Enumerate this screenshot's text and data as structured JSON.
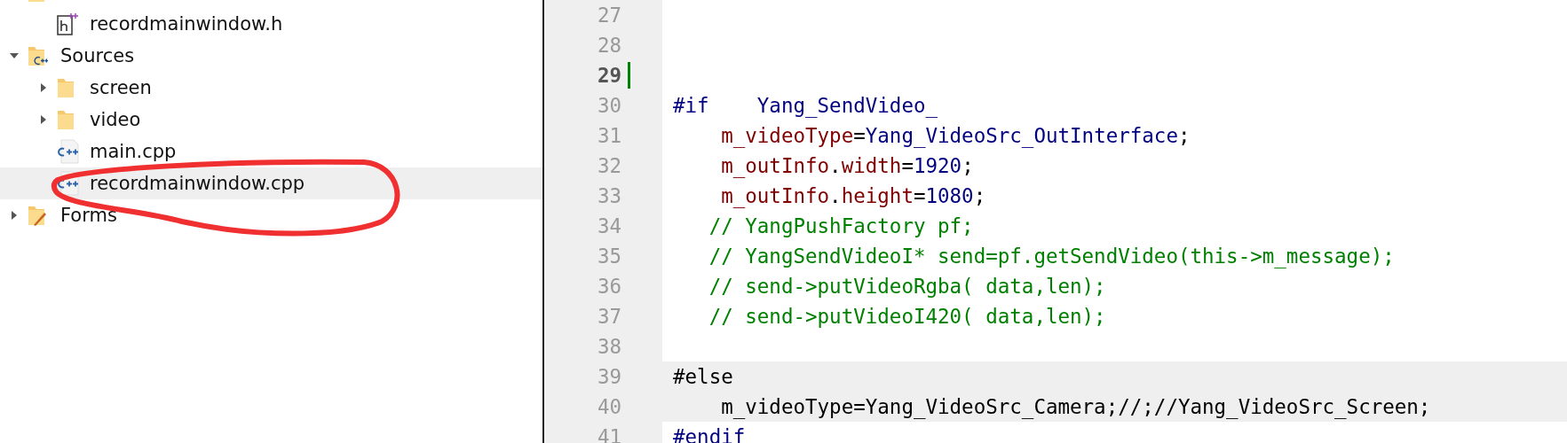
{
  "project_tree": {
    "items": [
      {
        "kind": "folder",
        "selected": false,
        "children": [
          {
            "kind": "header",
            "label": "recordmainwindow.h",
            "selected": false
          }
        ]
      },
      {
        "kind": "sources",
        "label": "Sources",
        "expanded": true,
        "selected": false,
        "children": [
          {
            "kind": "folder",
            "label": "screen",
            "expanded": false,
            "selected": false
          },
          {
            "kind": "folder",
            "label": "video",
            "expanded": false,
            "selected": false
          },
          {
            "kind": "cpp",
            "label": "main.cpp",
            "selected": false
          },
          {
            "kind": "cpp",
            "label": "recordmainwindow.cpp",
            "selected": true
          }
        ]
      },
      {
        "kind": "forms",
        "label": "Forms",
        "expanded": false,
        "selected": false
      }
    ]
  },
  "editor": {
    "lines": [
      {
        "number": "27",
        "current": false,
        "changed": false,
        "highlighted": false
      },
      {
        "number": "28",
        "current": false,
        "changed": false,
        "highlighted": false
      },
      {
        "number": "29",
        "current": true,
        "changed": true,
        "highlighted": false
      },
      {
        "number": "30",
        "current": false,
        "changed": false,
        "highlighted": false,
        "segments": [
          {
            "kind": "keyword",
            "text": "#if    Yang_SendVideo_"
          }
        ]
      },
      {
        "number": "31",
        "current": false,
        "changed": false,
        "highlighted": false,
        "segments": [
          {
            "kind": "member",
            "text": "    m_videoType"
          },
          {
            "kind": "plain",
            "text": "="
          },
          {
            "kind": "keyword",
            "text": "Yang_VideoSrc_OutInterface"
          },
          {
            "kind": "plain",
            "text": ";"
          }
        ]
      },
      {
        "number": "32",
        "current": false,
        "changed": false,
        "highlighted": false,
        "segments": [
          {
            "kind": "member",
            "text": "    m_outInfo"
          },
          {
            "kind": "plain",
            "text": "."
          },
          {
            "kind": "member",
            "text": "width"
          },
          {
            "kind": "plain",
            "text": "="
          },
          {
            "kind": "keyword",
            "text": "1920"
          },
          {
            "kind": "plain",
            "text": ";"
          }
        ]
      },
      {
        "number": "33",
        "current": false,
        "changed": false,
        "highlighted": false,
        "segments": [
          {
            "kind": "member",
            "text": "    m_outInfo"
          },
          {
            "kind": "plain",
            "text": "."
          },
          {
            "kind": "member",
            "text": "height"
          },
          {
            "kind": "plain",
            "text": "="
          },
          {
            "kind": "keyword",
            "text": "1080"
          },
          {
            "kind": "plain",
            "text": ";"
          }
        ]
      },
      {
        "number": "34",
        "current": false,
        "changed": false,
        "highlighted": false,
        "segments": [
          {
            "kind": "comment",
            "text": "   // YangPushFactory pf;"
          }
        ]
      },
      {
        "number": "35",
        "current": false,
        "changed": false,
        "highlighted": false,
        "segments": [
          {
            "kind": "comment",
            "text": "   // YangSendVideoI* send=pf.getSendVideo(this->m_message);"
          }
        ]
      },
      {
        "number": "36",
        "current": false,
        "changed": false,
        "highlighted": false,
        "segments": [
          {
            "kind": "comment",
            "text": "   // send->putVideoRgba( data,len);"
          }
        ]
      },
      {
        "number": "37",
        "current": false,
        "changed": false,
        "highlighted": false,
        "segments": [
          {
            "kind": "comment",
            "text": "   // send->putVideoI420( data,len);"
          }
        ]
      },
      {
        "number": "38",
        "current": false,
        "changed": false,
        "highlighted": false
      },
      {
        "number": "39",
        "current": false,
        "changed": false,
        "highlighted": true,
        "segments": [
          {
            "kind": "plain",
            "text": "#else"
          }
        ]
      },
      {
        "number": "40",
        "current": false,
        "changed": false,
        "highlighted": true,
        "segments": [
          {
            "kind": "plain",
            "text": "    m_videoType=Yang_VideoSrc_Camera;//;//Yang_VideoSrc_Screen;"
          }
        ]
      },
      {
        "number": "41",
        "current": false,
        "changed": false,
        "highlighted": false,
        "segments": [
          {
            "kind": "keyword",
            "text": "#endif"
          }
        ]
      }
    ]
  }
}
